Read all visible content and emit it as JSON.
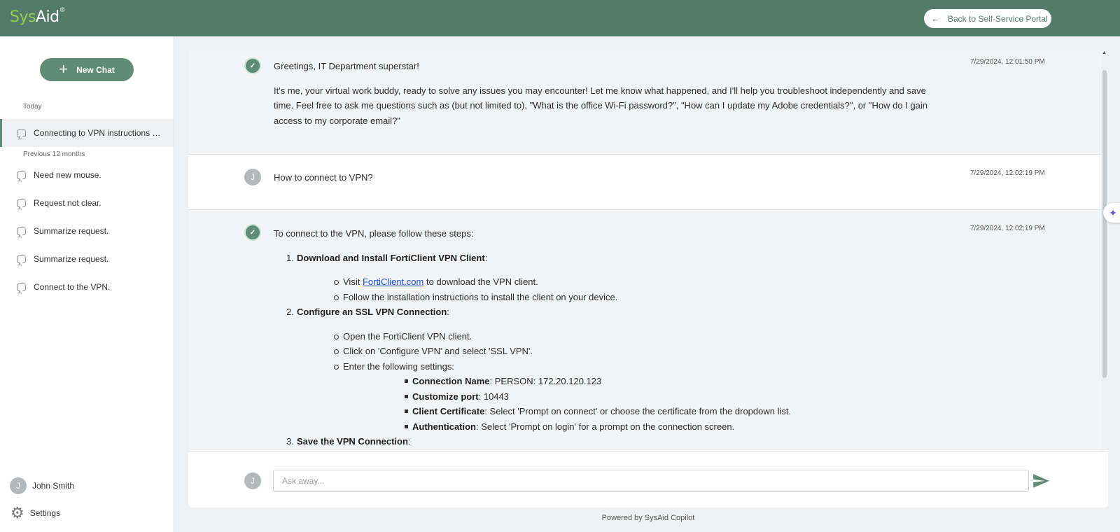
{
  "header": {
    "logo_sys": "Sys",
    "logo_aid": "Aid",
    "logo_reg": "®",
    "back_label": "Back to Self-Service Portal"
  },
  "sidebar": {
    "new_chat_label": "New Chat",
    "groups": [
      {
        "label": "Today"
      },
      {
        "label": "Previous 12 months"
      }
    ],
    "items": [
      {
        "label": "Connecting to VPN instructions n...",
        "active": true
      },
      {
        "label": "Need new mouse."
      },
      {
        "label": "Request not clear."
      },
      {
        "label": "Summarize request."
      },
      {
        "label": "Summarize request."
      },
      {
        "label": "Connect to the VPN."
      }
    ],
    "user": {
      "initial": "J",
      "name": "John Smith"
    },
    "settings_label": "Settings"
  },
  "messages": [
    {
      "role": "bot",
      "time": "7/29/2024, 12:01:50 PM",
      "greeting": "Greetings, IT Department superstar!",
      "text": "It's me, your virtual work buddy, ready to solve any issues you may encounter! Let me know what happened, and I'll help you troubleshoot independently and save time. Feel free to ask me questions such as (but not limited to), \"What is the office Wi-Fi password?\", \"How can I update my Adobe credentials?\", or \"How do I gain access to my corporate email?\""
    },
    {
      "role": "user",
      "initial": "J",
      "time": "7/29/2024, 12:02:19 PM",
      "text": "How to connect to VPN?"
    },
    {
      "role": "bot",
      "time": "7/29/2024, 12:02:19 PM",
      "intro": "To connect to the VPN, please follow these steps:",
      "steps": [
        {
          "num": "1.",
          "title": "Download and Install FortiClient VPN Client",
          "bullets": [
            {
              "pre": "Visit ",
              "link": "FortiClient.com",
              "post": " to download the VPN client."
            },
            {
              "text": "Follow the installation instructions to install the client on your device."
            }
          ]
        },
        {
          "num": "2.",
          "title": "Configure an SSL VPN Connection",
          "bullets": [
            {
              "text": "Open the FortiClient VPN client."
            },
            {
              "text": "Click on 'Configure VPN' and select 'SSL VPN'."
            },
            {
              "text": "Enter the following settings:"
            }
          ],
          "settings": [
            {
              "key": "Connection Name",
              "value": ": PERSON: 172.20.120.123"
            },
            {
              "key": "Customize port",
              "value": ": 10443"
            },
            {
              "key": "Client Certificate",
              "value": ": Select 'Prompt on connect' or choose the certificate from the dropdown list."
            },
            {
              "key": "Authentication",
              "value": ": Select 'Prompt on login' for a prompt on the connection screen."
            }
          ]
        },
        {
          "num": "3.",
          "title": "Save the VPN Connection"
        }
      ],
      "colon": ":"
    }
  ],
  "composer": {
    "initial": "J",
    "placeholder": "Ask away..."
  },
  "footer": "Powered by SysAid Copilot",
  "colors": {
    "header_bg": "#537a6a",
    "accent": "#5e8c79",
    "logo_green": "#8fd14f",
    "link": "#1a4fd0"
  }
}
